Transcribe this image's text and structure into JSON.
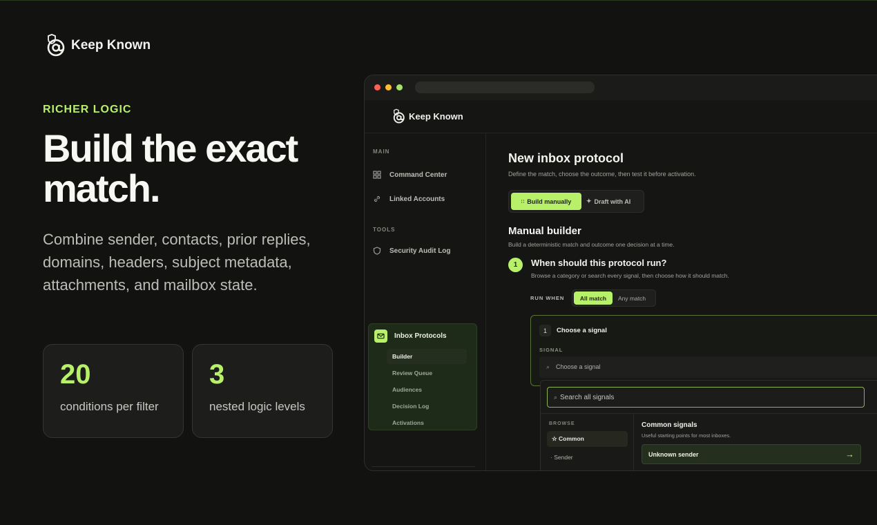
{
  "brand": {
    "name": "Keep Known"
  },
  "hero": {
    "eyebrow": "RICHER LOGIC",
    "headline": "Build the exact match.",
    "description": "Combine sender, contacts, prior replies, domains, headers, subject metadata, attachments, and mailbox state."
  },
  "stats": [
    {
      "value": "20",
      "label": "conditions per filter"
    },
    {
      "value": "3",
      "label": "nested logic levels"
    }
  ],
  "colors": {
    "accent": "#b9f06a",
    "background": "#121311",
    "window_close": "#ff5f57",
    "window_min": "#febc2e",
    "window_max": "#a6e26a"
  },
  "app": {
    "brand": "Keep Known",
    "sidebar": {
      "main_label": "MAIN",
      "main_items": [
        {
          "label": "Command Center",
          "icon": "grid-icon"
        },
        {
          "label": "Linked Accounts",
          "icon": "link-icon"
        }
      ],
      "tools_label": "TOOLS",
      "tools_items": [
        {
          "label": "Security Audit Log",
          "icon": "shield-icon"
        }
      ],
      "active_group": {
        "label": "Inbox Protocols",
        "icon": "mail-icon",
        "items": [
          "Builder",
          "Review Queue",
          "Audiences",
          "Decision Log",
          "Activations"
        ],
        "selected": "Builder"
      }
    },
    "main": {
      "title": "New inbox protocol",
      "subtitle": "Define the match, choose the outcome, then test it before activation.",
      "mode_on": "Build manually",
      "mode_off": "Draft with AI",
      "builder_title": "Manual builder",
      "builder_subtitle": "Build a deterministic match and outcome one decision at a time.",
      "step_number": "1",
      "question": "When should this protocol run?",
      "question_sub": "Browse a category or search every signal, then choose how it should match.",
      "run_when_label": "RUN WHEN",
      "run_when_on": "All match",
      "run_when_off": "Any match",
      "card": {
        "number": "1",
        "title": "Choose a signal",
        "field_label": "SIGNAL",
        "placeholder": "Choose a signal"
      },
      "dropdown": {
        "search_placeholder": "Search all signals",
        "browse_label": "BROWSE",
        "categories": [
          "Common",
          "Sender"
        ],
        "selected_category": "Common",
        "section_title": "Common signals",
        "section_sub": "Useful starting points for most inboxes.",
        "rows": [
          "Unknown sender"
        ]
      }
    }
  }
}
